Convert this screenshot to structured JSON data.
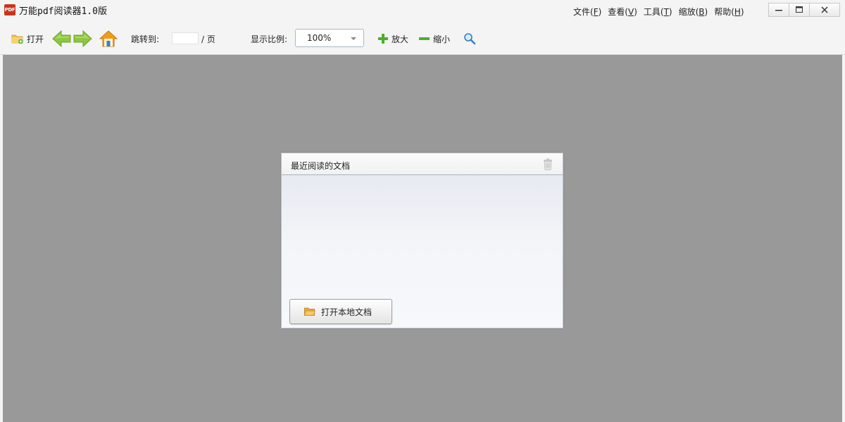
{
  "app": {
    "logo_text": "PDF",
    "title": "万能pdf阅读器1.0版"
  },
  "menu": [
    {
      "label": "文件(",
      "key": "F",
      "end": ")"
    },
    {
      "label": "查看(",
      "key": "V",
      "end": ")"
    },
    {
      "label": "工具(",
      "key": "T",
      "end": ")"
    },
    {
      "label": "缩放(",
      "key": "B",
      "end": ")"
    },
    {
      "label": "帮助(",
      "key": "H",
      "end": ")"
    }
  ],
  "window_controls": {
    "minimize_icon": "minimize-icon",
    "maximize_icon": "maximize-icon",
    "close_icon": "close-icon"
  },
  "toolbar": {
    "open_label": "打开",
    "goto_label": "跳转到:",
    "page_value": "",
    "page_suffix": "/ 页",
    "scale_label": "显示比例:",
    "scale_value": "100%",
    "zoom_in_label": "放大",
    "zoom_out_label": "缩小",
    "icons": {
      "open": "folder-add-icon",
      "prev": "arrow-left-icon",
      "next": "arrow-right-icon",
      "home": "home-icon",
      "zoom_in": "plus-icon",
      "zoom_out": "minus-icon",
      "search": "search-icon"
    }
  },
  "recent": {
    "title": "最近阅读的文档",
    "clear_icon": "trash-icon",
    "open_local_label": "打开本地文档",
    "open_local_icon": "open-folder-icon"
  },
  "colors": {
    "workspace_bg": "#999999",
    "logo_red": "#c8341c",
    "arrow_green": "#8ec63f",
    "plus_green": "#4caf2e",
    "home_orange": "#f39c12"
  }
}
